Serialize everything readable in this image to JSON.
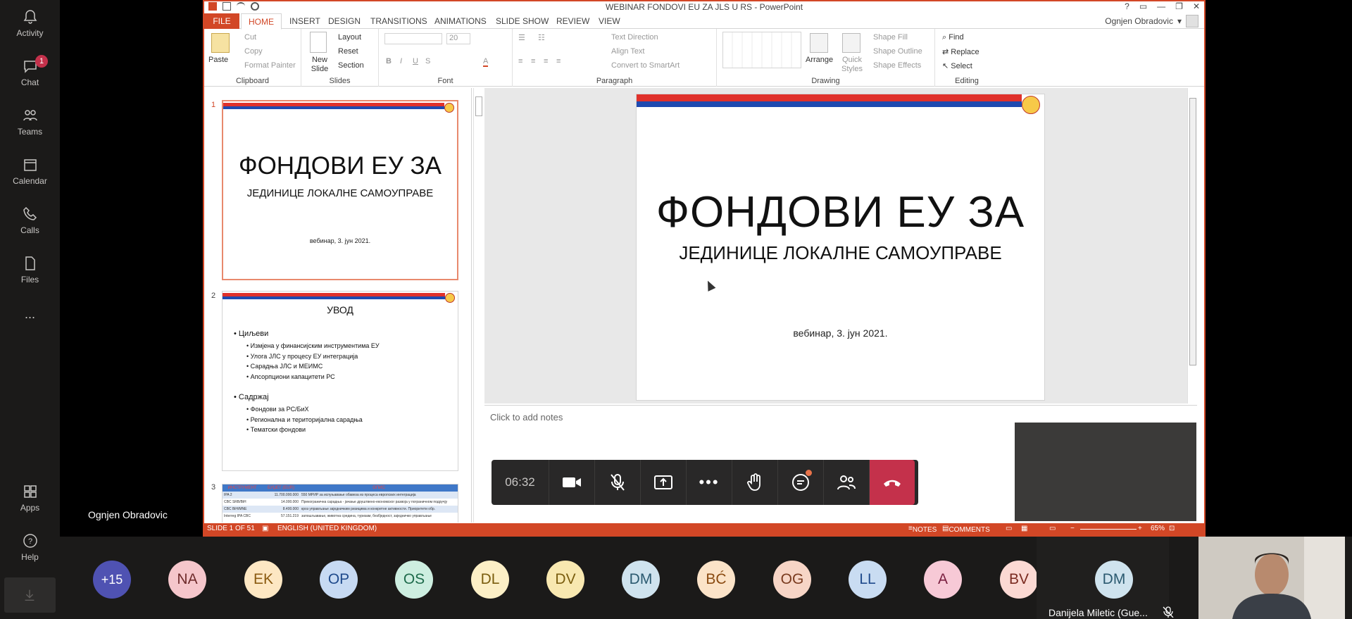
{
  "teams_rail": {
    "items": [
      {
        "label": "Activity",
        "icon": "bell-icon"
      },
      {
        "label": "Chat",
        "icon": "chat-icon",
        "badge": "1"
      },
      {
        "label": "Teams",
        "icon": "teams-icon"
      },
      {
        "label": "Calendar",
        "icon": "calendar-icon"
      },
      {
        "label": "Calls",
        "icon": "phone-icon"
      },
      {
        "label": "Files",
        "icon": "file-icon"
      },
      {
        "label": "...",
        "icon": "more-icon"
      }
    ],
    "apps_label": "Apps",
    "help_label": "Help"
  },
  "presenter_name": "Ognjen Obradovic",
  "ppt": {
    "window_title": "WEBINAR FONDOVI EU ZA JLS U RS - PowerPoint",
    "account_name": "Ognjen Obradovic",
    "tabs": [
      "FILE",
      "HOME",
      "INSERT",
      "DESIGN",
      "TRANSITIONS",
      "ANIMATIONS",
      "SLIDE SHOW",
      "REVIEW",
      "VIEW"
    ],
    "ribbon": {
      "clipboard": {
        "label": "Clipboard",
        "paste": "Paste",
        "cut": "Cut",
        "copy": "Copy",
        "format_painter": "Format Painter"
      },
      "slides": {
        "label": "Slides",
        "new_slide": "New Slide",
        "layout": "Layout",
        "reset": "Reset",
        "section": "Section"
      },
      "font": {
        "label": "Font",
        "size": "20"
      },
      "paragraph": {
        "label": "Paragraph",
        "text_direction": "Text Direction",
        "align_text": "Align Text",
        "smartart": "Convert to SmartArt"
      },
      "drawing": {
        "label": "Drawing",
        "arrange": "Arrange",
        "quick_styles": "Quick Styles",
        "shape_fill": "Shape Fill",
        "shape_outline": "Shape Outline",
        "shape_effects": "Shape Effects"
      },
      "editing": {
        "label": "Editing",
        "find": "Find",
        "replace": "Replace",
        "select": "Select"
      }
    },
    "thumbnails": [
      {
        "num": "1",
        "title": "ФОНДОВИ ЕУ ЗА",
        "sub": "ЈЕДИНИЦЕ ЛОКАЛНЕ САМОУПРАВЕ",
        "date": "вебинар, 3. јун 2021."
      },
      {
        "num": "2",
        "title": "УВОД",
        "sections": [
          {
            "head": "Циљеви",
            "items": [
              "Измјена у финансијским инструментима ЕУ",
              "Улога ЈЛС у процесу ЕУ интеграција",
              "Сарадња ЈЛС и МЕИМС",
              "Апсорпциони капацитети РС"
            ]
          },
          {
            "head": "Садржај",
            "items": [
              "Фондови за РС/БиХ",
              "Регионална и територијална сарадња",
              "Тематски фондови"
            ]
          }
        ]
      },
      {
        "num": "3",
        "table_headers": [
          "ИНСТРУМЕНТ",
          "БУЏЕТ (EUR)",
          "ОПИС"
        ],
        "rows": [
          [
            "IPA 2",
            "11.700.000.000",
            "550 МРИР за испуњавање обавеза из процеса европских интеграција"
          ],
          [
            "CBC SRB/BiH",
            "14.000.000",
            "Прекогранична сарадња - јачање друштвено-економског развоја у пограничном подручју"
          ],
          [
            "CBC BiH/MNE",
            "8.400.000",
            "кроз управљање заједничким ризицима и конкретне активности. Приоритети обр."
          ],
          [
            "Interreg IPA CBC",
            "57.151.219",
            "запошљавање, животна средина, туризам, безбједност, заједничко управљање"
          ]
        ]
      }
    ],
    "main_slide": {
      "title": "ФОНДОВИ ЕУ ЗА",
      "subtitle": "ЈЕДИНИЦЕ ЛОКАЛНЕ САМОУПРАВЕ",
      "date": "вебинар, 3. јун 2021."
    },
    "notes_placeholder": "Click to add notes",
    "status": {
      "slide": "SLIDE 1 OF 51",
      "language": "ENGLISH (UNITED KINGDOM)",
      "notes": "NOTES",
      "comments": "COMMENTS",
      "zoom": "65%"
    }
  },
  "meeting": {
    "timer": "06:32",
    "controls": [
      "camera-icon",
      "mic-off-icon",
      "share-icon",
      "more-icon",
      "raise-hand-icon",
      "chat-icon",
      "participants-icon",
      "hang-up-icon"
    ]
  },
  "participants": [
    {
      "initials": "+15",
      "bg": "#4f52b2",
      "fg": "#ffffff"
    },
    {
      "initials": "NA",
      "bg": "#f5c6cb",
      "fg": "#6e2b2b"
    },
    {
      "initials": "EK",
      "bg": "#fde7c3",
      "fg": "#8a5a10"
    },
    {
      "initials": "OP",
      "bg": "#c7daf3",
      "fg": "#1f4a8c"
    },
    {
      "initials": "OS",
      "bg": "#cdeee0",
      "fg": "#1e6b4b"
    },
    {
      "initials": "DL",
      "bg": "#fcefc6",
      "fg": "#7a5d0e"
    },
    {
      "initials": "DV",
      "bg": "#f8e8b0",
      "fg": "#7a5d0e"
    },
    {
      "initials": "DM",
      "bg": "#cfe3ee",
      "fg": "#2b5a70"
    },
    {
      "initials": "BĆ",
      "bg": "#fbe3c8",
      "fg": "#8a4a10"
    },
    {
      "initials": "OG",
      "bg": "#f7d5c6",
      "fg": "#7a3a1e"
    },
    {
      "initials": "LL",
      "bg": "#c9dcf2",
      "fg": "#1f4a8c"
    },
    {
      "initials": "A",
      "bg": "#f7c9d6",
      "fg": "#7a2040"
    },
    {
      "initials": "BV",
      "bg": "#fbd9d3",
      "fg": "#7a2b20"
    }
  ],
  "pinned": {
    "initials": "DM",
    "bg": "#cfe3ee",
    "fg": "#2b5a70",
    "name": "Danijela Miletic (Gue..."
  }
}
